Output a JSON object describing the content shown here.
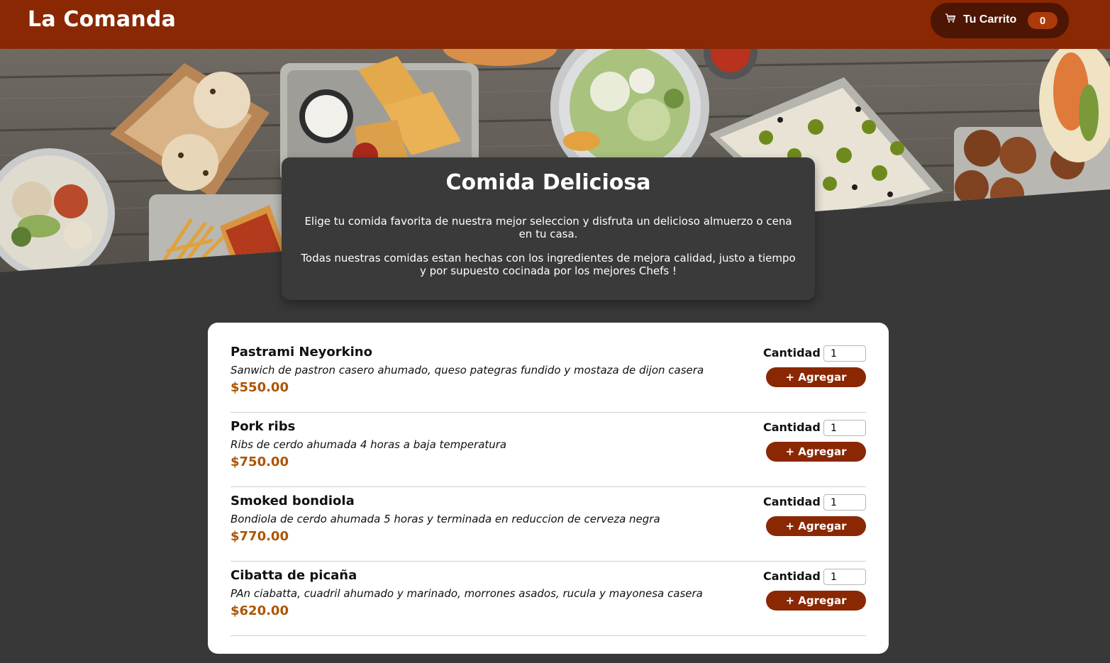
{
  "header": {
    "brand": "La Comanda",
    "cart": {
      "label": "Tu Carrito",
      "count": "0",
      "icon": "cart-icon"
    }
  },
  "hero": {
    "image": "food-table-photo",
    "title": "Comida Deliciosa",
    "paragraph_1": "Elige tu comida favorita de nuestra mejor seleccion y disfruta un delicioso almuerzo o cena en tu casa.",
    "paragraph_2": "Todas nuestras comidas estan hechas con los ingredientes de mejora calidad, justo a tiempo y por supuesto cocinada por los mejores Chefs !"
  },
  "meals": [
    {
      "name": "Pastrami Neyorkino",
      "description": "Sanwich de pastron casero ahumado, queso pategras fundido y mostaza de dijon casera",
      "price": "$550.00",
      "quantity_label": "Cantidad",
      "quantity": "1",
      "add_label": "+ Agregar"
    },
    {
      "name": "Pork ribs",
      "description": "Ribs de cerdo ahumada 4 horas a baja temperatura",
      "price": "$750.00",
      "quantity_label": "Cantidad",
      "quantity": "1",
      "add_label": "+ Agregar"
    },
    {
      "name": "Smoked bondiola",
      "description": "Bondiola de cerdo ahumada 5 horas y terminada en reduccion de cerveza negra",
      "price": "$770.00",
      "quantity_label": "Cantidad",
      "quantity": "1",
      "add_label": "+ Agregar"
    },
    {
      "name": "Cibatta de picaña",
      "description": "PAn ciabatta, cuadril ahumado y marinado, morrones asados, rucula y mayonesa casera",
      "price": "$620.00",
      "quantity_label": "Cantidad",
      "quantity": "1",
      "add_label": "+ Agregar"
    }
  ],
  "colors": {
    "header_bg": "#8a2804",
    "cart_bg": "#4d1503",
    "badge_bg": "#ad3a0b",
    "page_bg": "#383838",
    "price": "#ad5502",
    "button_bg": "#8a2804"
  }
}
